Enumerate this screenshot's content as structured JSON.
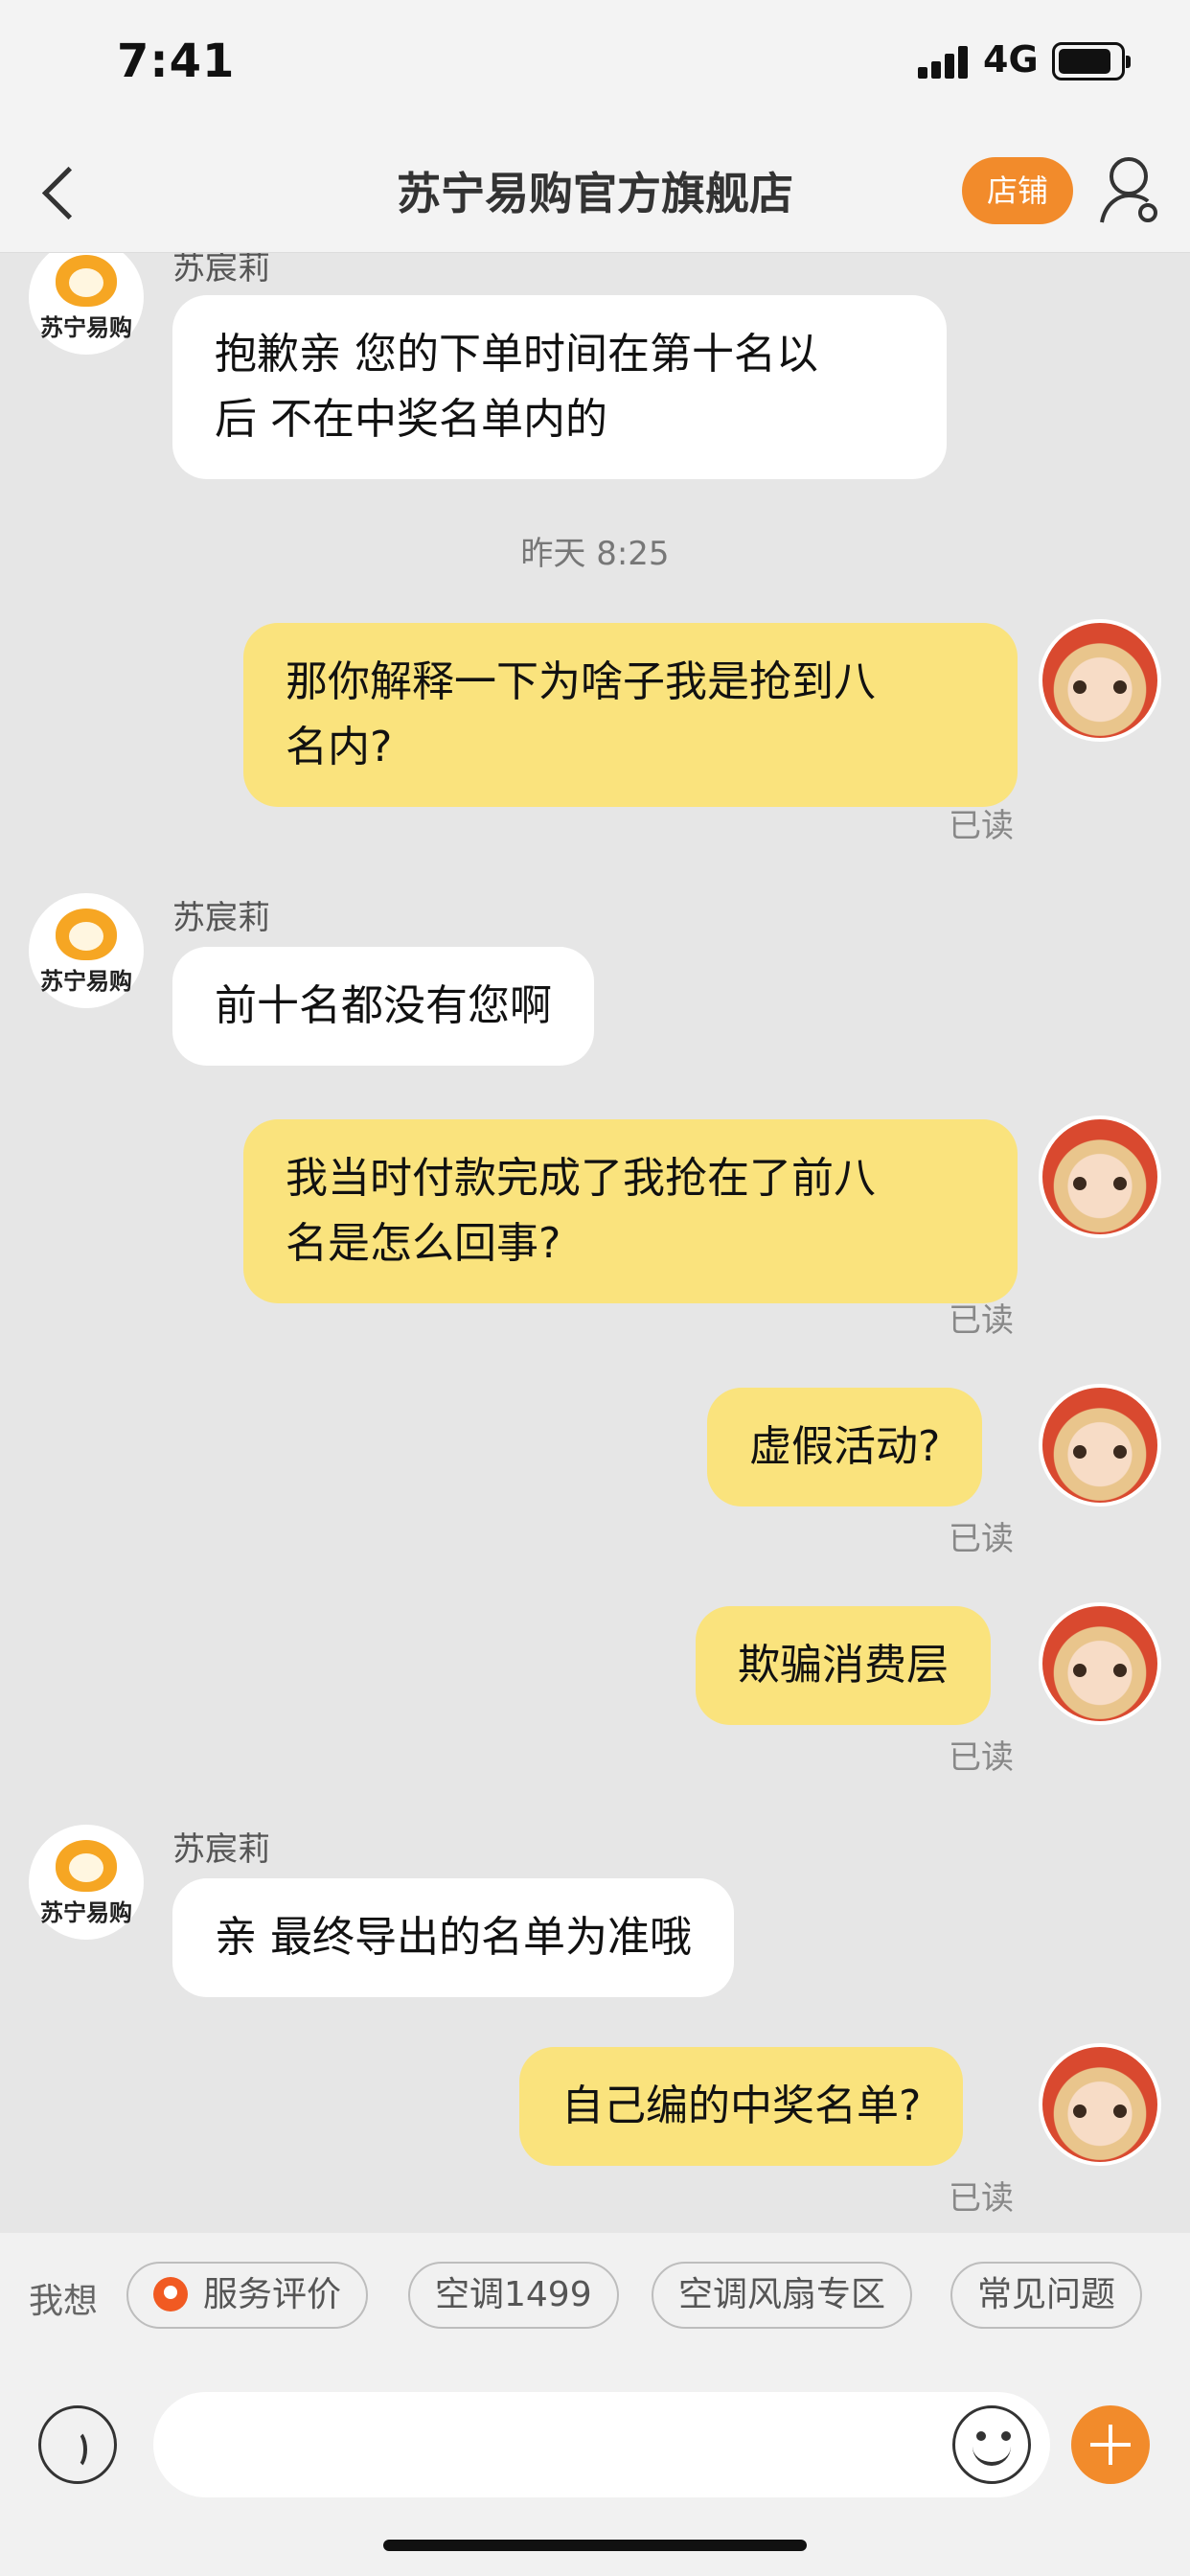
{
  "status_bar": {
    "time": "7:41",
    "network": "4G"
  },
  "header": {
    "title": "苏宁易购官方旗舰店",
    "store_button": "店铺"
  },
  "brand_avatar_text": "苏宁易购",
  "messages": [
    {
      "side": "left",
      "sender": "苏宸莉",
      "lines": [
        "抱歉亲 您的下单时间在第十名以",
        "后  不在中奖名单内的"
      ]
    },
    {
      "type": "timestamp",
      "text": "昨天 8:25"
    },
    {
      "side": "right",
      "lines": [
        "那你解释一下为啥子我是抢到八",
        "名内?"
      ],
      "status": "已读"
    },
    {
      "side": "left",
      "sender": "苏宸莉",
      "lines": [
        "前十名都没有您啊"
      ]
    },
    {
      "side": "right",
      "lines": [
        "我当时付款完成了我抢在了前八",
        "名是怎么回事?"
      ],
      "status": "已读"
    },
    {
      "side": "right",
      "lines": [
        "虚假活动?"
      ],
      "status": "已读"
    },
    {
      "side": "right",
      "lines": [
        "欺骗消费层"
      ],
      "status": "已读"
    },
    {
      "side": "left",
      "sender": "苏宸莉",
      "lines": [
        "亲 最终导出的名单为准哦"
      ]
    },
    {
      "side": "right",
      "lines": [
        "自己编的中奖名单?"
      ],
      "status": "已读"
    }
  ],
  "suggestions": {
    "label": "我想",
    "chips": [
      "服务评价",
      "空调1499",
      "空调风扇专区",
      "常见问题"
    ]
  },
  "input": {
    "placeholder": ""
  },
  "colors": {
    "accent": "#f28b2b",
    "self_bubble": "#fae37d",
    "background": "#e6e6e6"
  }
}
